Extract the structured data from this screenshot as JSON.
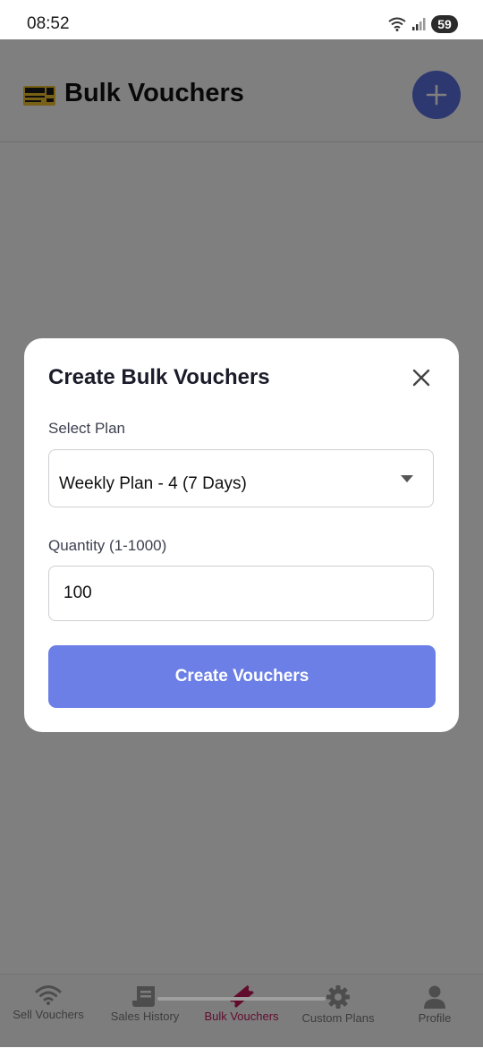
{
  "status_bar": {
    "time": "08:52",
    "battery": "59",
    "icons": [
      "wifi-icon",
      "signal-icon",
      "battery-icon"
    ]
  },
  "header": {
    "logo_icon": "ticket-logo-icon",
    "title": "Bulk Vouchers",
    "fab_icon": "plus-icon"
  },
  "modal": {
    "title": "Create Bulk Vouchers",
    "close_icon": "close-icon",
    "plan_label": "Select Plan",
    "plan_selected": "Weekly Plan - 4 (7 Days)",
    "quantity_label": "Quantity (1-1000)",
    "quantity_value": "100",
    "submit_label": "Create Vouchers"
  },
  "bottom_nav": {
    "items": [
      {
        "label": "Sell Vouchers",
        "icon": "wifi-icon",
        "active": false
      },
      {
        "label": "Sales History",
        "icon": "receipt-icon",
        "active": false
      },
      {
        "label": "Bulk Vouchers",
        "icon": "ticket-icon",
        "active": true
      },
      {
        "label": "Custom Plans",
        "icon": "gear-icon",
        "active": false
      },
      {
        "label": "Profile",
        "icon": "person-icon",
        "active": false
      }
    ]
  },
  "colors": {
    "accent": "#5b6ee1",
    "button": "#6b7fe6",
    "active_nav": "#c2185b",
    "overlay": "#00000080"
  }
}
